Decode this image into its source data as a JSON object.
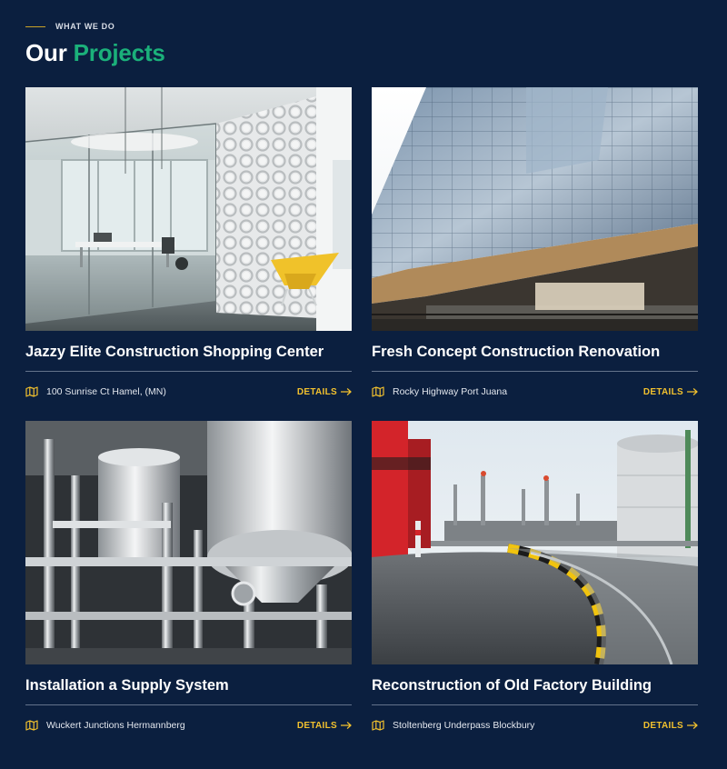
{
  "header": {
    "eyebrow": "WHAT WE DO",
    "title_main": "Our",
    "title_accent": "Projects"
  },
  "colors": {
    "background": "#0b1f3f",
    "accent_green": "#1bb07a",
    "accent_yellow": "#f2c12e",
    "eyebrow_line": "#c9a227"
  },
  "projects": [
    {
      "title": "Jazzy Elite Construction Shopping Center",
      "location": "100 Sunrise Ct Hamel, (MN)",
      "details_label": "DETAILS",
      "location_icon": "map-icon",
      "details_icon": "arrow-right-icon",
      "image": "modern office interior with glass walls and yellow chair"
    },
    {
      "title": "Fresh Concept Construction Renovation",
      "location": "Rocky Highway Port Juana",
      "details_label": "DETAILS",
      "location_icon": "map-icon",
      "details_icon": "arrow-right-icon",
      "image": "glass office tower facade"
    },
    {
      "title": "Installation a Supply System",
      "location": "Wuckert Junctions Hermannberg",
      "details_label": "DETAILS",
      "location_icon": "map-icon",
      "details_icon": "arrow-right-icon",
      "image": "stainless steel industrial pipes and tanks"
    },
    {
      "title": "Reconstruction of Old Factory Building",
      "location": "Stoltenberg Underpass Blockbury",
      "details_label": "DETAILS",
      "location_icon": "map-icon",
      "details_icon": "arrow-right-icon",
      "image": "industrial refinery with curved road and red building"
    }
  ]
}
